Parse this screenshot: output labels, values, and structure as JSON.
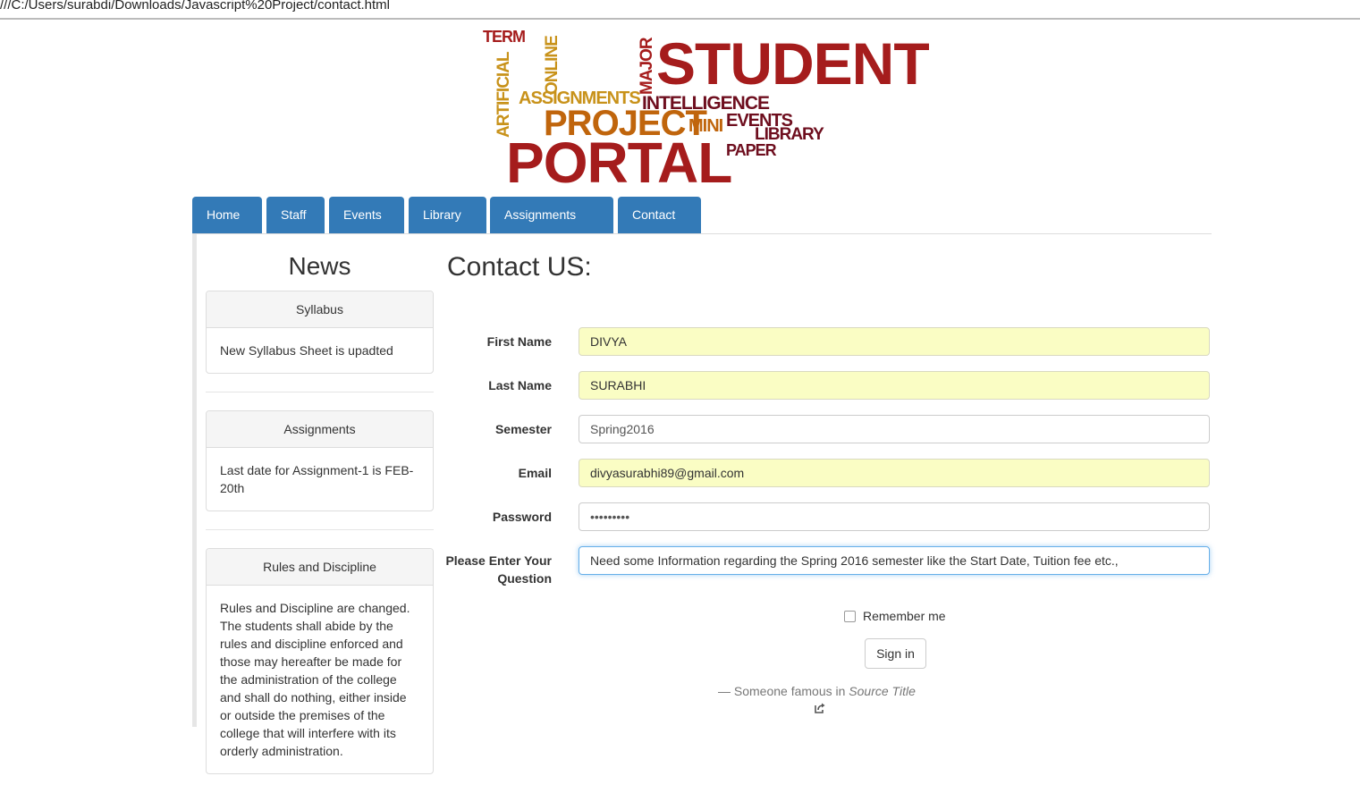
{
  "browser": {
    "url": "///C:/Users/surabdi/Downloads/Javascript%20Project/contact.html"
  },
  "logo": {
    "words": {
      "term": "TERM",
      "student": "STUDENT",
      "online": "ONLINE",
      "artificial": "ARTIFICIAL",
      "major": "MAJOR",
      "assignments": "ASSIGNMENTS",
      "intelligence": "INTELLIGENCE",
      "project": "PROJECT",
      "mini": "MINI",
      "events": "EVENTS",
      "library": "LIBRARY",
      "portal": "PORTAL",
      "paper": "PAPER"
    }
  },
  "nav": {
    "tabs": [
      {
        "label": "Home"
      },
      {
        "label": "Staff"
      },
      {
        "label": "Events"
      },
      {
        "label": "Library"
      },
      {
        "label": "Assignments"
      },
      {
        "label": "Contact"
      }
    ],
    "color": "#337ab7"
  },
  "news": {
    "title": "News",
    "panels": [
      {
        "heading": "Syllabus",
        "body": "New Syllabus Sheet is upadted"
      },
      {
        "heading": "Assignments",
        "body": "Last date for Assignment-1 is FEB-20th"
      },
      {
        "heading": "Rules and Discipline",
        "body": "Rules and Discipline are changed. The students shall abide by the rules and discipline enforced and those may hereafter be made for the administration of the college and shall do nothing, either inside or outside the premises of the college that will interfere with its orderly administration."
      }
    ]
  },
  "contact": {
    "title": "Contact US:",
    "fields": {
      "first_name": {
        "label": "First Name",
        "value": "DIVYA"
      },
      "last_name": {
        "label": "Last Name",
        "value": "SURABHI"
      },
      "semester": {
        "label": "Semester",
        "value": "Spring2016"
      },
      "email": {
        "label": "Email",
        "value": "divyasurabhi89@gmail.com"
      },
      "password": {
        "label": "Password",
        "value": "•••••••••"
      },
      "question": {
        "label": "Please Enter Your Question",
        "value": "Need some Information regarding the Spring 2016 semester like the Start Date, Tuition fee etc.,"
      }
    },
    "remember_label": "Remember me",
    "signin_label": "Sign in",
    "quote": {
      "prefix": "— Someone famous in",
      "source": "Source Title"
    }
  }
}
